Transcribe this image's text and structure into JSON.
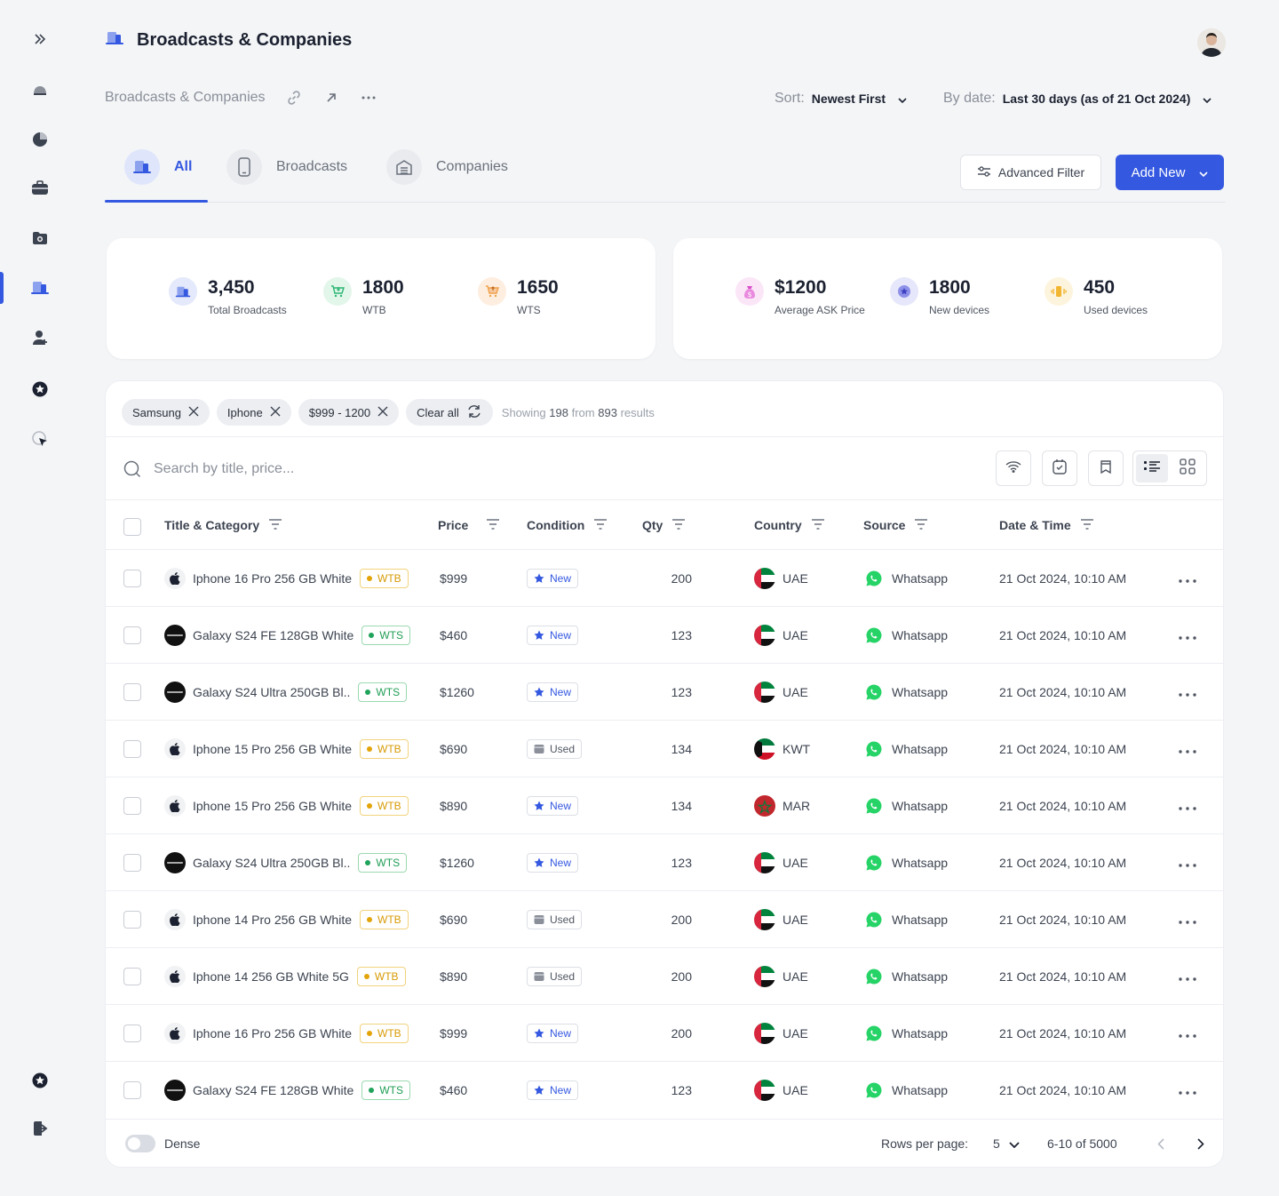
{
  "header": {
    "title": "Broadcasts & Companies",
    "breadcrumb": "Broadcasts & Companies",
    "sort_label": "Sort:",
    "sort_value": "Newest First",
    "date_label": "By date:",
    "date_value": "Last 30 days (as of 21 Oct 2024)"
  },
  "tabs": [
    {
      "label": "All",
      "icon": "broadcast-icon",
      "active": true
    },
    {
      "label": "Broadcasts",
      "icon": "phone-icon",
      "active": false
    },
    {
      "label": "Companies",
      "icon": "building-icon",
      "active": false
    }
  ],
  "actions": {
    "advanced_filter": "Advanced Filter",
    "add_new": "Add New"
  },
  "stats_left": [
    {
      "value": "3,450",
      "label": "Total Broadcasts",
      "color": "#3458e0"
    },
    {
      "value": "1800",
      "label": "WTB",
      "color": "#2bb673"
    },
    {
      "value": "1650",
      "label": "WTS",
      "color": "#f0a24b"
    }
  ],
  "stats_right": [
    {
      "value": "$1200",
      "label": "Average ASK Price",
      "color": "#d94fc9"
    },
    {
      "value": "1800",
      "label": "New devices",
      "color": "#5a5fd6"
    },
    {
      "value": "450",
      "label": "Used devices",
      "color": "#f2b632"
    }
  ],
  "filters": {
    "chips": [
      "Samsung",
      "Iphone",
      "$999 - 1200"
    ],
    "clear_all": "Clear all",
    "showing_prefix": "Showing",
    "showing_count": "198",
    "showing_mid": "from",
    "showing_total": "893",
    "showing_suffix": "results"
  },
  "search": {
    "placeholder": "Search by title, price..."
  },
  "columns": {
    "title": "Title & Category",
    "price": "Price",
    "condition": "Condition",
    "qty": "Qty",
    "country": "Country",
    "source": "Source",
    "date": "Date & Time"
  },
  "rows": [
    {
      "brand": "apple",
      "title": "Iphone 16 Pro 256 GB White",
      "type": "WTB",
      "price": "$999",
      "condition": "New",
      "qty": "200",
      "country": "UAE",
      "source": "Whatsapp",
      "date": "21 Oct 2024, 10:10 AM"
    },
    {
      "brand": "samsung",
      "title": "Galaxy S24 FE 128GB White",
      "type": "WTS",
      "price": "$460",
      "condition": "New",
      "qty": "123",
      "country": "UAE",
      "source": "Whatsapp",
      "date": "21 Oct 2024, 10:10 AM"
    },
    {
      "brand": "samsung",
      "title": "Galaxy S24 Ultra 250GB Bl..",
      "type": "WTS",
      "price": "$1260",
      "condition": "New",
      "qty": "123",
      "country": "UAE",
      "source": "Whatsapp",
      "date": "21 Oct 2024, 10:10 AM"
    },
    {
      "brand": "apple",
      "title": "Iphone 15 Pro 256 GB White",
      "type": "WTB",
      "price": "$690",
      "condition": "Used",
      "qty": "134",
      "country": "KWT",
      "source": "Whatsapp",
      "date": "21 Oct 2024, 10:10 AM"
    },
    {
      "brand": "apple",
      "title": "Iphone 15 Pro 256 GB White",
      "type": "WTB",
      "price": "$890",
      "condition": "New",
      "qty": "134",
      "country": "MAR",
      "source": "Whatsapp",
      "date": "21 Oct 2024, 10:10 AM"
    },
    {
      "brand": "samsung",
      "title": "Galaxy S24 Ultra 250GB Bl..",
      "type": "WTS",
      "price": "$1260",
      "condition": "New",
      "qty": "123",
      "country": "UAE",
      "source": "Whatsapp",
      "date": "21 Oct 2024, 10:10 AM"
    },
    {
      "brand": "apple",
      "title": "Iphone 14 Pro 256 GB White",
      "type": "WTB",
      "price": "$690",
      "condition": "Used",
      "qty": "200",
      "country": "UAE",
      "source": "Whatsapp",
      "date": "21 Oct 2024, 10:10 AM"
    },
    {
      "brand": "apple",
      "title": "Iphone 14  256 GB White 5G",
      "type": "WTB",
      "price": "$890",
      "condition": "Used",
      "qty": "200",
      "country": "UAE",
      "source": "Whatsapp",
      "date": "21 Oct 2024, 10:10 AM"
    },
    {
      "brand": "apple",
      "title": "Iphone 16 Pro 256 GB White",
      "type": "WTB",
      "price": "$999",
      "condition": "New",
      "qty": "200",
      "country": "UAE",
      "source": "Whatsapp",
      "date": "21 Oct 2024, 10:10 AM"
    },
    {
      "brand": "samsung",
      "title": "Galaxy S24 FE 128GB White",
      "type": "WTS",
      "price": "$460",
      "condition": "New",
      "qty": "123",
      "country": "UAE",
      "source": "Whatsapp",
      "date": "21 Oct 2024, 10:10 AM"
    }
  ],
  "footer": {
    "dense_label": "Dense",
    "rows_per_page_label": "Rows per page:",
    "rows_per_page": "5",
    "range": "6-10 of 5000"
  },
  "colors": {
    "accent": "#3458e0",
    "wtb": "#e2a409",
    "wts": "#20a35a",
    "whatsapp": "#25d366"
  }
}
